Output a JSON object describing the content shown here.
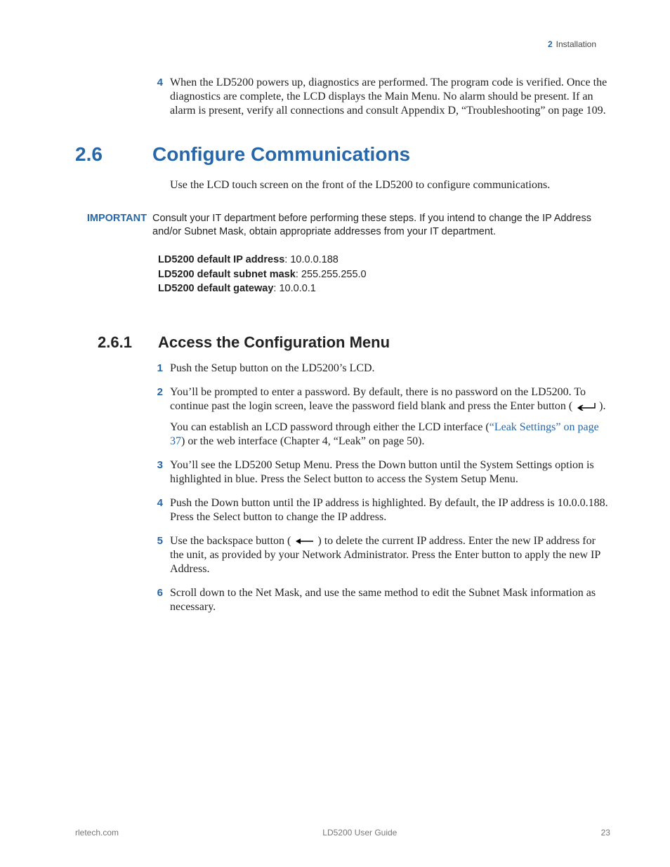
{
  "header": {
    "chapter_num": "2",
    "chapter_title": "Installation"
  },
  "top_step": {
    "num": "4",
    "text": "When the LD5200 powers up, diagnostics are performed. The program code is verified. Once the diagnostics are complete, the LCD displays the Main Menu. No alarm should be present. If an alarm is present, verify all connections and consult Appendix D, “Troubleshooting” on page 109."
  },
  "section": {
    "num": "2.6",
    "title": "Configure Communications",
    "intro": "Use the LCD touch screen on the front of the LD5200 to configure communications."
  },
  "important": {
    "label": "IMPORTANT",
    "text": "Consult your IT department before performing these steps. If you intend to change the IP Address and/or Subnet Mask, obtain appropriate addresses from your IT department."
  },
  "defaults": {
    "ip_label": "LD5200 default IP address",
    "ip_value": ": 10.0.0.188",
    "mask_label": "LD5200 default subnet mask",
    "mask_value": ": 255.255.255.0",
    "gw_label": "LD5200 default gateway",
    "gw_value": ": 10.0.0.1"
  },
  "subsection": {
    "num": "2.6.1",
    "title": "Access the Configuration Menu",
    "steps": {
      "s1": {
        "num": "1",
        "text": "Push the Setup button on the LD5200’s LCD."
      },
      "s2": {
        "num": "2",
        "p1a": "You’ll be prompted to enter a password. By default, there is no password on the LD5200. To continue past the login screen, leave the password field blank and press the Enter button ( ",
        "p1b": " ).",
        "p2a": "You can establish an LCD password through either the LCD interface (",
        "p2link": "“Leak Settings” on page 37",
        "p2b": ") or the web interface (Chapter 4, “Leak” on page 50)."
      },
      "s3": {
        "num": "3",
        "text": "You’ll see the LD5200 Setup Menu. Press the Down button until the System Settings option is highlighted in blue. Press the Select button to access the System Setup Menu."
      },
      "s4": {
        "num": "4",
        "text": "Push the Down button until the IP address is highlighted. By default, the IP address is 10.0.0.188. Press the Select button to change the IP address."
      },
      "s5": {
        "num": "5",
        "pa": "Use the backspace button ( ",
        "pb": " ) to delete the current IP address. Enter the new IP address for the unit, as provided by your Network Administrator. Press the Enter button to apply the new IP Address."
      },
      "s6": {
        "num": "6",
        "text": "Scroll down to the Net Mask, and use the same method to edit the Subnet Mask information as necessary."
      }
    }
  },
  "footer": {
    "left": "rletech.com",
    "center": "LD5200 User Guide",
    "right": "23"
  }
}
